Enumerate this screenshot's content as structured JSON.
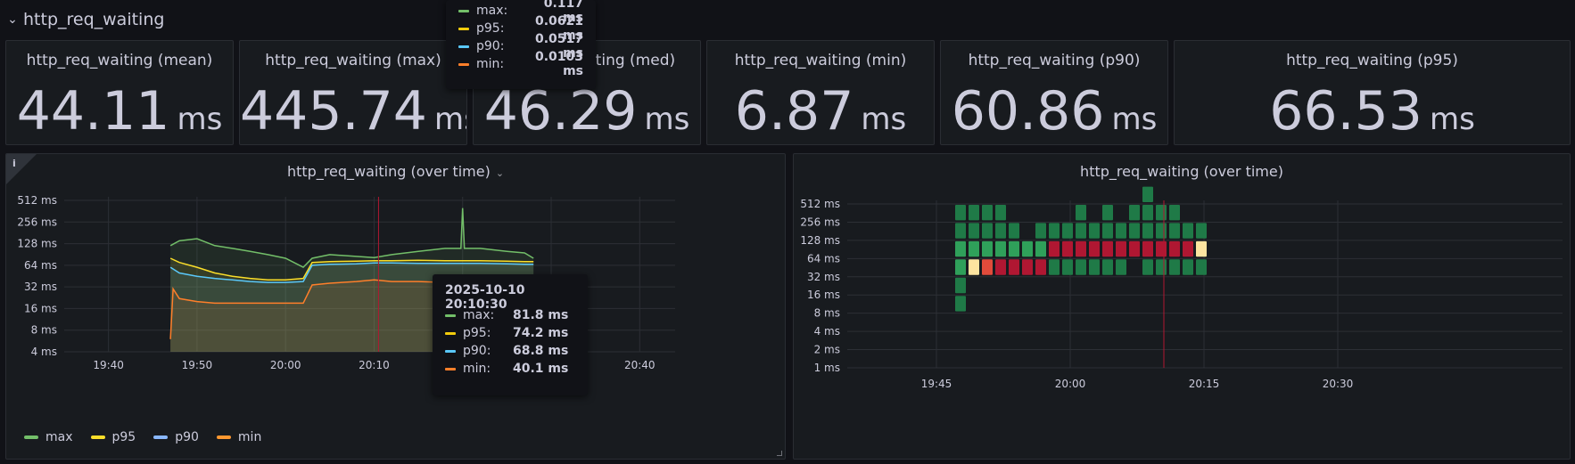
{
  "row": {
    "title": "http_req_waiting",
    "chevron": "⌄"
  },
  "stats": [
    {
      "title": "http_req_waiting (mean)",
      "value": "44.11",
      "unit": "ms"
    },
    {
      "title": "http_req_waiting (max)",
      "value": "445.74",
      "unit": "ms"
    },
    {
      "title": "http_req_waiting (med)",
      "value": "46.29",
      "unit": "ms"
    },
    {
      "title": "http_req_waiting (min)",
      "value": "6.87",
      "unit": "ms"
    },
    {
      "title": "http_req_waiting (p90)",
      "value": "60.86",
      "unit": "ms"
    },
    {
      "title": "http_req_waiting (p95)",
      "value": "66.53",
      "unit": "ms"
    }
  ],
  "timeseries_panel": {
    "title": "http_req_waiting (over time)",
    "info_icon": "i",
    "legend": [
      {
        "name": "max",
        "color": "#73bf69"
      },
      {
        "name": "p95",
        "color": "#fade2a"
      },
      {
        "name": "p90",
        "color": "#8ab8ff"
      },
      {
        "name": "min",
        "color": "#ff9830"
      }
    ]
  },
  "heatmap_panel": {
    "title": "http_req_waiting (over time)"
  },
  "tooltip_main": {
    "time": "2025-10-10 20:10:30",
    "rows": [
      {
        "label": "max:",
        "value": "81.8 ms",
        "color": "#73bf69"
      },
      {
        "label": "p95:",
        "value": "74.2 ms",
        "color": "#f2cc0c"
      },
      {
        "label": "p90:",
        "value": "68.8 ms",
        "color": "#5ac8fa"
      },
      {
        "label": "min:",
        "value": "40.1 ms",
        "color": "#ff7f2a"
      }
    ]
  },
  "tooltip_top": {
    "rows": [
      {
        "label": "max:",
        "value": "0.117 ms",
        "color": "#73bf69"
      },
      {
        "label": "p95:",
        "value": "0.0621 ms",
        "color": "#f2cc0c"
      },
      {
        "label": "p90:",
        "value": "0.0517 ms",
        "color": "#5ac8fa"
      },
      {
        "label": "min:",
        "value": "0.0103 ms",
        "color": "#ff7f2a"
      }
    ]
  },
  "chart_data": [
    {
      "type": "line",
      "title": "http_req_waiting (over time)",
      "y_scale": "log2",
      "y_ticks": [
        "512 ms",
        "256 ms",
        "128 ms",
        "64 ms",
        "32 ms",
        "16 ms",
        "8 ms",
        "4 ms"
      ],
      "x_ticks": [
        "19:40",
        "19:50",
        "20:00",
        "20:10",
        "20:20",
        "20:30",
        "20:40"
      ],
      "x_range": [
        "19:35",
        "20:44"
      ],
      "ylim_ms": [
        4,
        512
      ],
      "cursor_time": "20:10:30",
      "series": [
        {
          "name": "max",
          "color": "#73bf69",
          "x": [
            "19:47",
            "19:48",
            "19:50",
            "19:52",
            "19:54",
            "19:56",
            "19:58",
            "20:00",
            "20:02",
            "20:03",
            "20:05",
            "20:08",
            "20:10",
            "20:12",
            "20:15",
            "20:18",
            "20:19.8",
            "20:20",
            "20:20.2",
            "20:22",
            "20:25",
            "20:27",
            "20:28"
          ],
          "values": [
            120,
            140,
            150,
            120,
            110,
            100,
            90,
            80,
            60,
            80,
            90,
            85,
            82,
            90,
            100,
            110,
            110,
            400,
            110,
            110,
            100,
            95,
            80
          ]
        },
        {
          "name": "p95",
          "color": "#fade2a",
          "x": [
            "19:47",
            "19:48",
            "19:50",
            "19:52",
            "19:54",
            "19:56",
            "19:58",
            "20:00",
            "20:02",
            "20:03",
            "20:05",
            "20:08",
            "20:10",
            "20:12",
            "20:15",
            "20:18",
            "20:20",
            "20:22",
            "20:25",
            "20:27",
            "20:28"
          ],
          "values": [
            80,
            70,
            60,
            50,
            45,
            42,
            40,
            40,
            42,
            70,
            72,
            73,
            74,
            74,
            75,
            74,
            74,
            74,
            73,
            72,
            72
          ]
        },
        {
          "name": "p90",
          "color": "#5ac8fa",
          "x": [
            "19:47",
            "19:48",
            "19:50",
            "19:52",
            "19:54",
            "19:56",
            "19:58",
            "20:00",
            "20:02",
            "20:03",
            "20:05",
            "20:08",
            "20:10",
            "20:12",
            "20:15",
            "20:18",
            "20:20",
            "20:22",
            "20:25",
            "20:27",
            "20:28"
          ],
          "values": [
            60,
            50,
            45,
            42,
            40,
            38,
            37,
            37,
            38,
            64,
            66,
            67,
            69,
            69,
            68,
            68,
            68,
            68,
            67,
            66,
            66
          ]
        },
        {
          "name": "min",
          "color": "#ff7f2a",
          "x": [
            "19:47",
            "19:47.3",
            "19:48",
            "19:50",
            "19:52",
            "19:55",
            "19:58",
            "20:00",
            "20:02",
            "20:03",
            "20:05",
            "20:08",
            "20:10",
            "20:12",
            "20:15",
            "20:18",
            "20:20",
            "20:25",
            "20:28"
          ],
          "values": [
            6,
            30,
            22,
            20,
            19,
            19,
            19,
            19,
            19,
            34,
            36,
            38,
            40,
            38,
            38,
            37,
            38,
            38,
            42
          ]
        }
      ]
    },
    {
      "type": "heatmap",
      "title": "http_req_waiting (over time)",
      "y_scale": "log2",
      "y_ticks": [
        "512 ms",
        "256 ms",
        "128 ms",
        "64 ms",
        "32 ms",
        "16 ms",
        "8 ms",
        "4 ms",
        "2 ms",
        "1 ms"
      ],
      "x_ticks": [
        "19:45",
        "20:00",
        "20:15",
        "20:30"
      ],
      "cursor_time": "20:10:30",
      "bucket_time_start": "19:47",
      "bucket_minutes": 1.5,
      "colors": {
        "dark_green": "#1f7a47",
        "green": "#2fa05a",
        "dark_red": "#b01732",
        "red": "#e14b3b",
        "cream": "#fde4a0"
      },
      "rows": [
        {
          "bucket_ms": 256,
          "cells": [
            "dark_green",
            "dark_green",
            "dark_green",
            "dark_green",
            "",
            "",
            "",
            "",
            "",
            "dark_green",
            "",
            "dark_green",
            "",
            "dark_green",
            "dark_green",
            "dark_green",
            "dark_green",
            "",
            ""
          ]
        },
        {
          "bucket_ms": 128,
          "cells": [
            "dark_green",
            "dark_green",
            "dark_green",
            "dark_green",
            "dark_green",
            "",
            "dark_green",
            "dark_green",
            "dark_green",
            "dark_green",
            "dark_green",
            "dark_green",
            "dark_green",
            "dark_green",
            "dark_green",
            "dark_green",
            "dark_green",
            "dark_green",
            "dark_green"
          ]
        },
        {
          "bucket_ms": 64,
          "cells": [
            "green",
            "green",
            "green",
            "green",
            "green",
            "green",
            "green",
            "dark_red",
            "dark_red",
            "dark_red",
            "dark_red",
            "dark_red",
            "dark_red",
            "dark_red",
            "dark_red",
            "dark_red",
            "dark_red",
            "dark_red",
            "cream"
          ]
        },
        {
          "bucket_ms": 32,
          "cells": [
            "green",
            "cream",
            "red",
            "dark_red",
            "dark_red",
            "dark_red",
            "dark_red",
            "dark_green",
            "dark_green",
            "dark_green",
            "dark_green",
            "dark_green",
            "dark_green",
            "",
            "dark_green",
            "dark_green",
            "dark_green",
            "dark_green",
            "dark_green"
          ]
        },
        {
          "bucket_ms": 16,
          "cells": [
            "dark_green",
            "",
            "",
            "",
            "",
            "",
            "",
            "",
            "",
            "",
            "",
            "",
            "",
            "",
            "",
            "",
            "",
            "",
            ""
          ]
        },
        {
          "bucket_ms": 8,
          "cells": [
            "dark_green",
            "",
            "",
            "",
            "",
            "",
            "",
            "",
            "",
            "",
            "",
            "",
            "",
            "",
            "",
            "",
            "",
            "",
            ""
          ]
        }
      ],
      "extra_cells": [
        {
          "bucket_ms": 512,
          "col": 14,
          "color": "dark_green"
        }
      ]
    }
  ]
}
